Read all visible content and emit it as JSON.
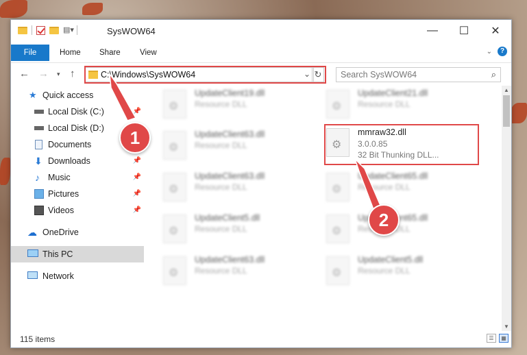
{
  "window": {
    "title": "SysWOW64",
    "controls": [
      "—",
      "☐",
      "✕"
    ]
  },
  "ribbon": {
    "tabs": [
      "File",
      "Home",
      "Share",
      "View"
    ]
  },
  "address": {
    "path": "C:\\Windows\\SysWOW64",
    "search_placeholder": "Search SysWOW64"
  },
  "sidebar": {
    "items": [
      {
        "label": "Quick access",
        "icon": "star-icon"
      },
      {
        "label": "Local Disk (C:)",
        "icon": "drive-icon"
      },
      {
        "label": "Local Disk (D:)",
        "icon": "drive-icon"
      },
      {
        "label": "Documents",
        "icon": "documents-icon"
      },
      {
        "label": "Downloads",
        "icon": "downloads-icon"
      },
      {
        "label": "Music",
        "icon": "music-icon"
      },
      {
        "label": "Pictures",
        "icon": "pictures-icon"
      },
      {
        "label": "Videos",
        "icon": "videos-icon"
      },
      {
        "label": "OneDrive",
        "icon": "cloud-icon"
      },
      {
        "label": "This PC",
        "icon": "monitor-icon"
      },
      {
        "label": "Network",
        "icon": "network-icon"
      }
    ]
  },
  "files": {
    "left": [
      {
        "name": "UpdateClient19.dll",
        "desc": "Resource DLL"
      },
      {
        "name": "UpdateClient63.dll",
        "desc": "Resource DLL"
      },
      {
        "name": "UpdateClient63.dll",
        "desc": "Resource DLL"
      },
      {
        "name": "UpdateClient5.dll",
        "desc": "Resource DLL"
      },
      {
        "name": "UpdateClient63.dll",
        "desc": "Resource DLL"
      }
    ],
    "right": [
      {
        "name": "UpdateClient21.dll",
        "desc": "Resource DLL"
      },
      {
        "name": "UpdateClient65.dll",
        "desc": "Resource DLL"
      },
      {
        "name": "UpdateClient65.dll",
        "desc": "Resource DLL"
      },
      {
        "name": "UpdateClient5.dll",
        "desc": "Resource DLL"
      }
    ],
    "highlighted": {
      "name": "mmraw32.dll",
      "version": "3.0.0.85",
      "desc": "32 Bit Thunking DLL..."
    }
  },
  "status": {
    "items_count": "115 items"
  },
  "callouts": [
    "1",
    "2"
  ],
  "colors": {
    "accent": "#1979ca",
    "highlight": "#e04848"
  }
}
